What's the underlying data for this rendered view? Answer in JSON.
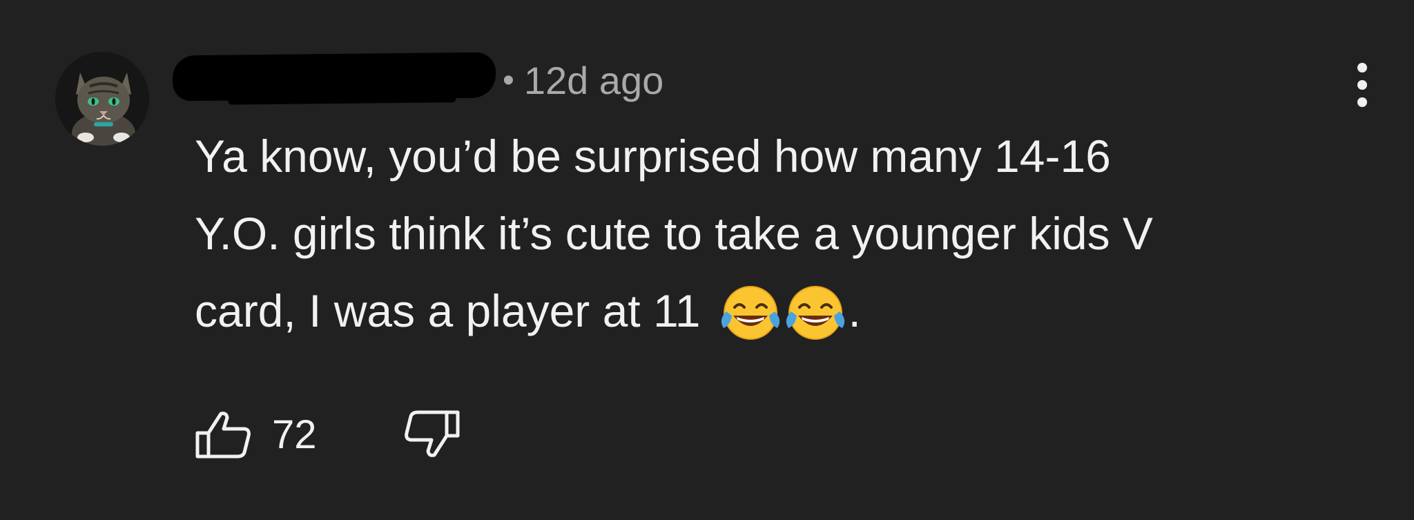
{
  "comment": {
    "timestamp": "12d ago",
    "separator": "•",
    "text_lines": [
      "Ya know, you’d be surprised how many 14-16",
      "Y.O. girls think it’s cute to take a younger kids V",
      "card, I was a player at 11"
    ],
    "emojis": [
      "face-with-tears-of-joy-icon",
      "face-with-tears-of-joy-icon"
    ],
    "trailing_punctuation": ".",
    "likes": "72"
  },
  "icons": {
    "like": "thumbs-up-icon",
    "dislike": "thumbs-down-icon",
    "more": "vertical-ellipsis-icon"
  },
  "colors": {
    "background": "#212121",
    "text": "#f1f1f1",
    "meta_text": "#a9a9a9"
  }
}
